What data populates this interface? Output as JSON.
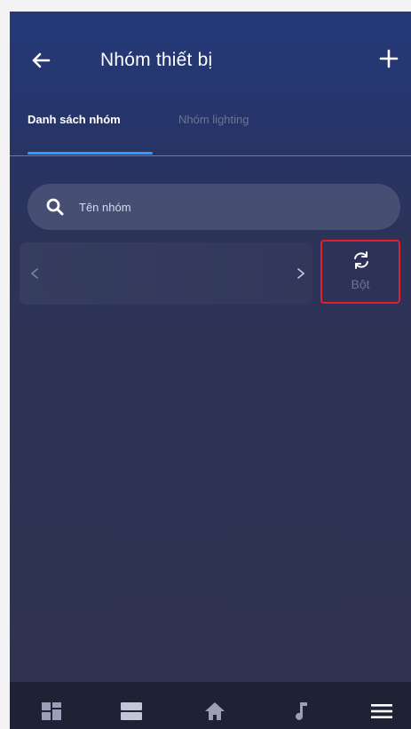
{
  "header": {
    "title": "Nhóm thiết bị",
    "back_icon": "arrow-left-icon",
    "add_icon": "plus-icon"
  },
  "tabs": [
    {
      "label": "Danh sách nhóm",
      "active": true
    },
    {
      "label": "Nhóm lighting",
      "active": false
    }
  ],
  "search": {
    "placeholder": "Tên nhóm",
    "value": ""
  },
  "scroller": {
    "left_icon": "chevron-left-icon",
    "right_icon": "chevron-right-icon"
  },
  "bot_button": {
    "label": "Bột",
    "icon": "refresh-icon",
    "highlight_color": "#e0202a"
  },
  "bottom_nav": [
    {
      "icon": "dashboard-grid-icon"
    },
    {
      "icon": "rows-layout-icon"
    },
    {
      "icon": "home-icon"
    },
    {
      "icon": "music-note-icon"
    },
    {
      "icon": "menu-icon"
    }
  ],
  "colors": {
    "accent": "#2e9bff",
    "background_top": "#243a7a",
    "background_bottom": "#30334f",
    "nav_bar": "#1f2235"
  }
}
